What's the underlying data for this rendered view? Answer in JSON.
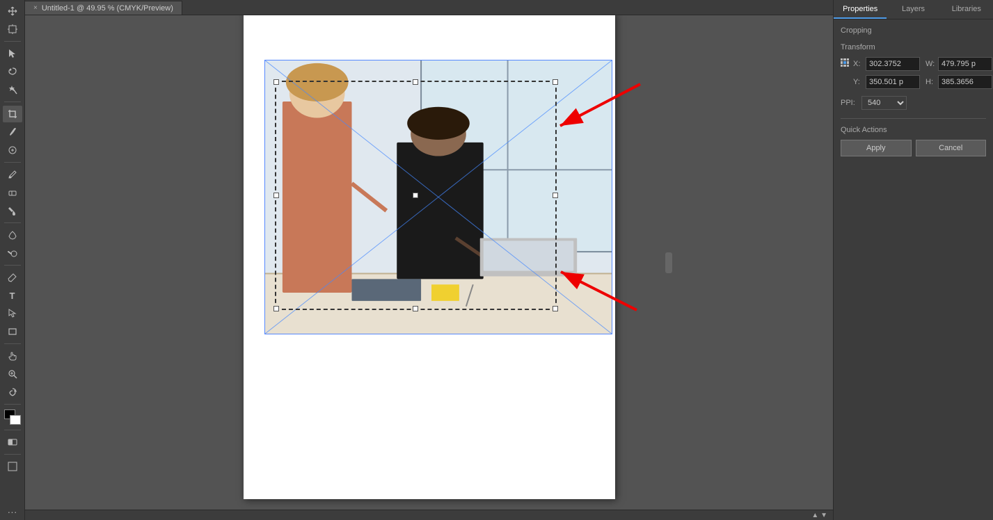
{
  "titleBar": {
    "title": "Untitled-1 @ 49.95 % (CMYK/Preview)",
    "closeIcon": "×"
  },
  "tab": {
    "label": "Untitled-1 @ 49.95 % (CMYK/Preview)"
  },
  "toolbar": {
    "tools": [
      {
        "name": "move",
        "icon": "↖",
        "label": "Move Tool"
      },
      {
        "name": "artboard",
        "icon": "⬜",
        "label": "Artboard Tool"
      },
      {
        "name": "select",
        "icon": "▷",
        "label": "Select Tool"
      },
      {
        "name": "lasso",
        "icon": "⌒",
        "label": "Lasso Tool"
      },
      {
        "name": "magic-wand",
        "icon": "✦",
        "label": "Magic Wand"
      },
      {
        "name": "crop",
        "icon": "⊡",
        "label": "Crop Tool"
      },
      {
        "name": "eyedropper",
        "icon": "💧",
        "label": "Eyedropper"
      },
      {
        "name": "patch",
        "icon": "⊕",
        "label": "Patch Tool"
      },
      {
        "name": "brush",
        "icon": "🖌",
        "label": "Brush"
      },
      {
        "name": "eraser",
        "icon": "⬜",
        "label": "Eraser"
      },
      {
        "name": "paint-bucket",
        "icon": "◎",
        "label": "Paint Bucket"
      },
      {
        "name": "blur",
        "icon": "△",
        "label": "Blur"
      },
      {
        "name": "dodge",
        "icon": "◌",
        "label": "Dodge"
      },
      {
        "name": "pen",
        "icon": "✒",
        "label": "Pen Tool"
      },
      {
        "name": "text",
        "icon": "T",
        "label": "Type Tool"
      },
      {
        "name": "path-selection",
        "icon": "↗",
        "label": "Path Selection"
      },
      {
        "name": "rectangle",
        "icon": "▭",
        "label": "Rectangle Tool"
      },
      {
        "name": "hand",
        "icon": "✋",
        "label": "Hand Tool"
      },
      {
        "name": "zoom",
        "icon": "🔍",
        "label": "Zoom Tool"
      },
      {
        "name": "rotate-view",
        "icon": "↺",
        "label": "Rotate View"
      },
      {
        "name": "swap",
        "icon": "⇄",
        "label": "Swap"
      }
    ]
  },
  "rightPanel": {
    "tabs": [
      {
        "label": "Properties",
        "active": true
      },
      {
        "label": "Layers",
        "active": false
      },
      {
        "label": "Libraries",
        "active": false
      }
    ],
    "sections": {
      "cropping": {
        "title": "Cropping"
      },
      "transform": {
        "title": "Transform",
        "x": {
          "label": "X:",
          "value": "302.3752"
        },
        "y": {
          "label": "Y:",
          "value": "350.501 p"
        },
        "w": {
          "label": "W:",
          "value": "479.795 p"
        },
        "h": {
          "label": "H:",
          "value": "385.3656"
        },
        "ppi": {
          "label": "PPI:",
          "value": "540"
        }
      },
      "quickActions": {
        "title": "Quick Actions",
        "applyButton": "Apply",
        "cancelButton": "Cancel"
      }
    }
  },
  "canvas": {
    "zoom": "49.95%",
    "mode": "CMYK/Preview"
  }
}
